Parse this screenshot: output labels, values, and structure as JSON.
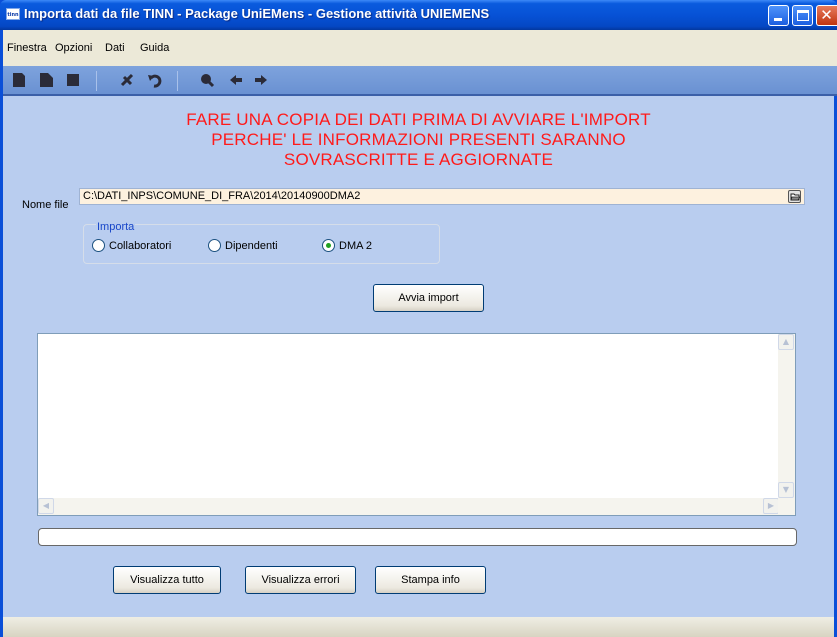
{
  "window": {
    "icon_text": "tinn",
    "title": "Importa dati da file TINN - Package UniEMens - Gestione attività UNIEMENS"
  },
  "menu": [
    "Finestra",
    "Opzioni",
    "Dati",
    "Guida"
  ],
  "toolbar": {
    "icons": [
      "new-icon",
      "open-icon",
      "save-icon",
      "cut-icon",
      "undo-icon",
      "search-icon",
      "back-arrow-icon",
      "forward-arrow-icon"
    ]
  },
  "warning": {
    "line1": "FARE UNA COPIA DEI DATI PRIMA DI AVVIARE L'IMPORT",
    "line2": "PERCHE' LE INFORMAZIONI PRESENTI SARANNO",
    "line3": "SOVRASCRITTE E AGGIORNATE"
  },
  "file": {
    "label": "Nome file",
    "value": "C:\\DATI_INPS\\COMUNE_DI_FRA\\2014\\20140900DMA2"
  },
  "import_group": {
    "legend": "Importa",
    "options": [
      "Collaboratori",
      "Dipendenti",
      "DMA 2"
    ],
    "selected": "DMA 2"
  },
  "buttons": {
    "start": "Avvia import",
    "show_all": "Visualizza tutto",
    "show_errors": "Visualizza errori",
    "print_info": "Stampa info"
  },
  "log": {
    "content": ""
  },
  "progress": {
    "value": 0
  },
  "colors": {
    "warning": "#ff1a1a",
    "background": "#b9cdef",
    "titlebar": "#0752d6",
    "legend": "#1846c9"
  }
}
